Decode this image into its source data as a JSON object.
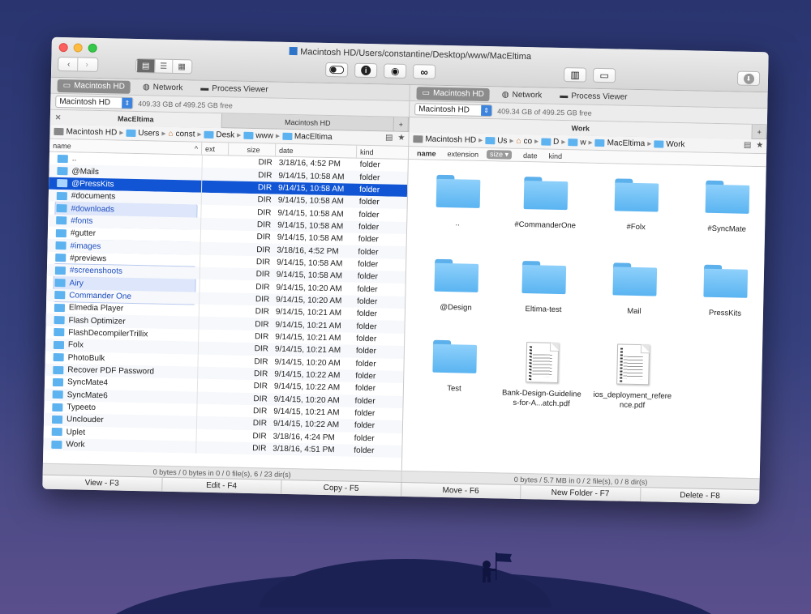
{
  "window": {
    "title": "Macintosh HD/Users/constantine/Desktop/www/MacEltima"
  },
  "toolbar": {
    "back": "‹",
    "forward": "›",
    "view_modes": [
      "▤",
      "☰",
      "▦"
    ],
    "toggle_icon": "toggle-icon",
    "info": "i",
    "eye": "◉",
    "binoculars": "∞",
    "split": "▥",
    "network_drive": "▭",
    "download": "⬇"
  },
  "left": {
    "locations": [
      "Macintosh HD",
      "Network",
      "Process Viewer"
    ],
    "drive": "Macintosh HD",
    "free": "409.33 GB of 499.25 GB free",
    "tabs": [
      "MacEltima",
      "Macintosh HD"
    ],
    "tab_close": "✕",
    "tab_add": "+",
    "breadcrumb": [
      "Macintosh HD",
      "Users",
      "const",
      "Desk",
      "www",
      "MacEltima"
    ],
    "crumb_sep": "▸",
    "tools": [
      "▤",
      "★"
    ],
    "columns": [
      "name",
      "ext",
      "size",
      "date",
      "kind"
    ],
    "sort_indicator": "^",
    "rows": [
      {
        "name": "..",
        "size": "DIR",
        "date": "3/18/16, 4:52 PM",
        "kind": "folder"
      },
      {
        "name": "@Mails",
        "size": "DIR",
        "date": "9/14/15, 10:58 AM",
        "kind": "folder"
      },
      {
        "name": "@PressKits",
        "size": "DIR",
        "date": "9/14/15, 10:58 AM",
        "kind": "folder"
      },
      {
        "name": "#documents",
        "size": "DIR",
        "date": "9/14/15, 10:58 AM",
        "kind": "folder"
      },
      {
        "name": "#downloads",
        "size": "DIR",
        "date": "9/14/15, 10:58 AM",
        "kind": "folder"
      },
      {
        "name": "#fonts",
        "size": "DIR",
        "date": "9/14/15, 10:58 AM",
        "kind": "folder"
      },
      {
        "name": "#gutter",
        "size": "DIR",
        "date": "9/14/15, 10:58 AM",
        "kind": "folder"
      },
      {
        "name": "#images",
        "size": "DIR",
        "date": "3/18/16, 4:52 PM",
        "kind": "folder"
      },
      {
        "name": "#previews",
        "size": "DIR",
        "date": "9/14/15, 10:58 AM",
        "kind": "folder"
      },
      {
        "name": "#screenshoots",
        "size": "DIR",
        "date": "9/14/15, 10:58 AM",
        "kind": "folder"
      },
      {
        "name": "Airy",
        "size": "DIR",
        "date": "9/14/15, 10:20 AM",
        "kind": "folder"
      },
      {
        "name": "Commander One",
        "size": "DIR",
        "date": "9/14/15, 10:20 AM",
        "kind": "folder"
      },
      {
        "name": "Elmedia Player",
        "size": "DIR",
        "date": "9/14/15, 10:21 AM",
        "kind": "folder"
      },
      {
        "name": "Flash Optimizer",
        "size": "DIR",
        "date": "9/14/15, 10:21 AM",
        "kind": "folder"
      },
      {
        "name": "FlashDecompilerTrillix",
        "size": "DIR",
        "date": "9/14/15, 10:21 AM",
        "kind": "folder"
      },
      {
        "name": "Folx",
        "size": "DIR",
        "date": "9/14/15, 10:21 AM",
        "kind": "folder"
      },
      {
        "name": "PhotoBulk",
        "size": "DIR",
        "date": "9/14/15, 10:20 AM",
        "kind": "folder"
      },
      {
        "name": "Recover PDF Password",
        "size": "DIR",
        "date": "9/14/15, 10:22 AM",
        "kind": "folder"
      },
      {
        "name": "SyncMate4",
        "size": "DIR",
        "date": "9/14/15, 10:22 AM",
        "kind": "folder"
      },
      {
        "name": "SyncMate6",
        "size": "DIR",
        "date": "9/14/15, 10:20 AM",
        "kind": "folder"
      },
      {
        "name": "Typeeto",
        "size": "DIR",
        "date": "9/14/15, 10:21 AM",
        "kind": "folder"
      },
      {
        "name": "Unclouder",
        "size": "DIR",
        "date": "9/14/15, 10:22 AM",
        "kind": "folder"
      },
      {
        "name": "Uplet",
        "size": "DIR",
        "date": "3/18/16, 4:24 PM",
        "kind": "folder"
      },
      {
        "name": "Work",
        "size": "DIR",
        "date": "3/18/16, 4:51 PM",
        "kind": "folder"
      }
    ],
    "status": "0 bytes / 0 bytes in 0 / 0 file(s), 6 / 23 dir(s)"
  },
  "right": {
    "locations": [
      "Macintosh HD",
      "Network",
      "Process Viewer"
    ],
    "drive": "Macintosh HD",
    "free": "409.34 GB of 499.25 GB free",
    "tabs": [
      "Work"
    ],
    "tab_add": "+",
    "breadcrumb": [
      "Macintosh HD",
      "Us",
      "co",
      "D",
      "w",
      "MacEltima",
      "Work"
    ],
    "crumb_sep": "▸",
    "tools": [
      "▤",
      "★"
    ],
    "sort_fields": [
      "name",
      "extension",
      "size ▾",
      "date",
      "kind"
    ],
    "items": [
      {
        "name": "..",
        "type": "folder"
      },
      {
        "name": "#CommanderOne",
        "type": "folder"
      },
      {
        "name": "#Folx",
        "type": "folder"
      },
      {
        "name": "#SyncMate",
        "type": "folder"
      },
      {
        "name": "@Design",
        "type": "folder"
      },
      {
        "name": "Eltima-test",
        "type": "folder"
      },
      {
        "name": "Mail",
        "type": "folder"
      },
      {
        "name": "PressKits",
        "type": "folder"
      },
      {
        "name": "Test",
        "type": "folder"
      },
      {
        "name": "Bank-Design-Guidelines-for-A...atch.pdf",
        "type": "pdf"
      },
      {
        "name": "ios_deployment_reference.pdf",
        "type": "pdf"
      }
    ],
    "status": "0 bytes / 5.7 MB in 0 / 2 file(s), 0 / 8 dir(s)"
  },
  "function_keys": [
    "View - F3",
    "Edit - F4",
    "Copy - F5",
    "Move - F6",
    "New Folder - F7",
    "Delete - F8"
  ],
  "colors": {
    "selection": "#1155d5",
    "folder": "#5ab4f1"
  }
}
